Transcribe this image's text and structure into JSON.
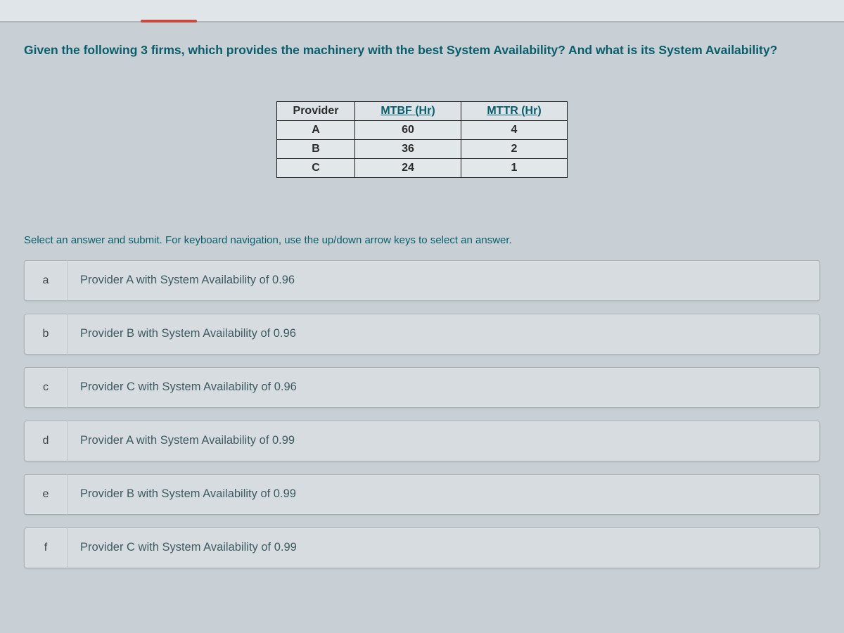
{
  "question": "Given the following 3 firms, which provides the machinery with the best System Availability? And what is its System Availability?",
  "table": {
    "headers": [
      "Provider",
      "MTBF (Hr)",
      "MTTR (Hr)"
    ],
    "rows": [
      {
        "provider": "A",
        "mtbf": "60",
        "mttr": "4"
      },
      {
        "provider": "B",
        "mtbf": "36",
        "mttr": "2"
      },
      {
        "provider": "C",
        "mtbf": "24",
        "mttr": "1"
      }
    ]
  },
  "instruction": "Select an answer and submit. For keyboard navigation, use the up/down arrow keys to select an answer.",
  "options": [
    {
      "key": "a",
      "text": "Provider A with System Availability of 0.96"
    },
    {
      "key": "b",
      "text": "Provider B with System Availability of 0.96"
    },
    {
      "key": "c",
      "text": "Provider C with System Availability of 0.96"
    },
    {
      "key": "d",
      "text": "Provider A with System Availability of 0.99"
    },
    {
      "key": "e",
      "text": "Provider B with System Availability of 0.99"
    },
    {
      "key": "f",
      "text": "Provider C with System Availability of 0.99"
    }
  ],
  "chart_data": {
    "type": "table",
    "title": "Provider MTBF and MTTR",
    "columns": [
      "Provider",
      "MTBF (Hr)",
      "MTTR (Hr)"
    ],
    "rows": [
      [
        "A",
        60,
        4
      ],
      [
        "B",
        36,
        2
      ],
      [
        "C",
        24,
        1
      ]
    ]
  }
}
